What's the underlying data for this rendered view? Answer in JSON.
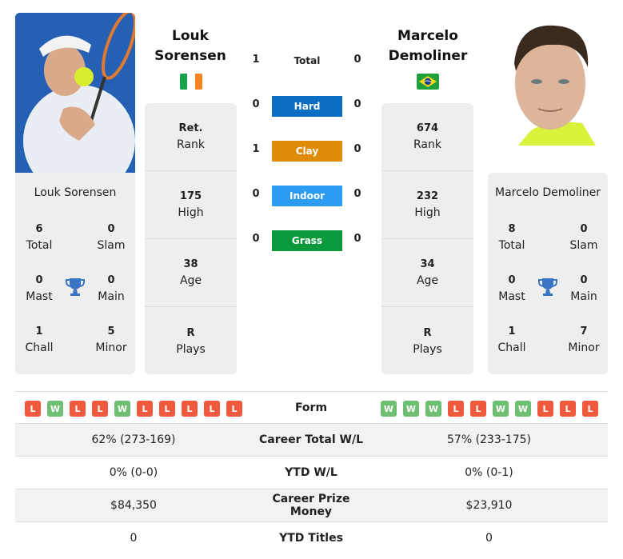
{
  "colors": {
    "hard": "#0b6ec2",
    "clay": "#de8b0a",
    "indoor": "#2b9cf2",
    "grass": "#0a9a3c",
    "win": "#6fbf73",
    "loss": "#ef5a3f",
    "trophy": "#3a74c4",
    "card_bg": "#eeeeee"
  },
  "player1": {
    "first_name": "Louk",
    "last_name": "Sorensen",
    "full_name": "Louk Sorensen",
    "flag": "ireland-flag",
    "photo": "player-photo",
    "rank": {
      "value": "Ret.",
      "label": "Rank"
    },
    "high": {
      "value": "175",
      "label": "High"
    },
    "age": {
      "value": "38",
      "label": "Age"
    },
    "plays": {
      "value": "R",
      "label": "Plays"
    },
    "titles": {
      "total": {
        "value": "6",
        "label": "Total"
      },
      "slam": {
        "value": "0",
        "label": "Slam"
      },
      "mast": {
        "value": "0",
        "label": "Mast"
      },
      "main": {
        "value": "0",
        "label": "Main"
      },
      "chall": {
        "value": "1",
        "label": "Chall"
      },
      "minor": {
        "value": "5",
        "label": "Minor"
      }
    },
    "form": [
      "L",
      "W",
      "L",
      "L",
      "W",
      "L",
      "L",
      "L",
      "L",
      "L"
    ]
  },
  "player2": {
    "first_name": "Marcelo",
    "last_name": "Demoliner",
    "full_name": "Marcelo Demoliner",
    "flag": "brazil-flag",
    "photo": "player-photo",
    "rank": {
      "value": "674",
      "label": "Rank"
    },
    "high": {
      "value": "232",
      "label": "High"
    },
    "age": {
      "value": "34",
      "label": "Age"
    },
    "plays": {
      "value": "R",
      "label": "Plays"
    },
    "titles": {
      "total": {
        "value": "8",
        "label": "Total"
      },
      "slam": {
        "value": "0",
        "label": "Slam"
      },
      "mast": {
        "value": "0",
        "label": "Mast"
      },
      "main": {
        "value": "0",
        "label": "Main"
      },
      "chall": {
        "value": "1",
        "label": "Chall"
      },
      "minor": {
        "value": "7",
        "label": "Minor"
      }
    },
    "form": [
      "W",
      "W",
      "W",
      "L",
      "L",
      "W",
      "W",
      "L",
      "L",
      "L"
    ]
  },
  "h2h": {
    "total": {
      "label": "Total",
      "p1": "1",
      "p2": "0"
    },
    "surfaces": [
      {
        "label": "Hard",
        "p1": "0",
        "p2": "0"
      },
      {
        "label": "Clay",
        "p1": "1",
        "p2": "0"
      },
      {
        "label": "Indoor",
        "p1": "0",
        "p2": "0"
      },
      {
        "label": "Grass",
        "p1": "0",
        "p2": "0"
      }
    ]
  },
  "comparison": {
    "form_label": "Form",
    "rows": [
      {
        "label": "Career Total W/L",
        "p1": "62% (273-169)",
        "p2": "57% (233-175)"
      },
      {
        "label": "YTD W/L",
        "p1": "0% (0-0)",
        "p2": "0% (0-1)"
      },
      {
        "label": "Career Prize Money",
        "p1": "$84,350",
        "p2": "$23,910"
      },
      {
        "label": "YTD Titles",
        "p1": "0",
        "p2": "0"
      }
    ]
  }
}
